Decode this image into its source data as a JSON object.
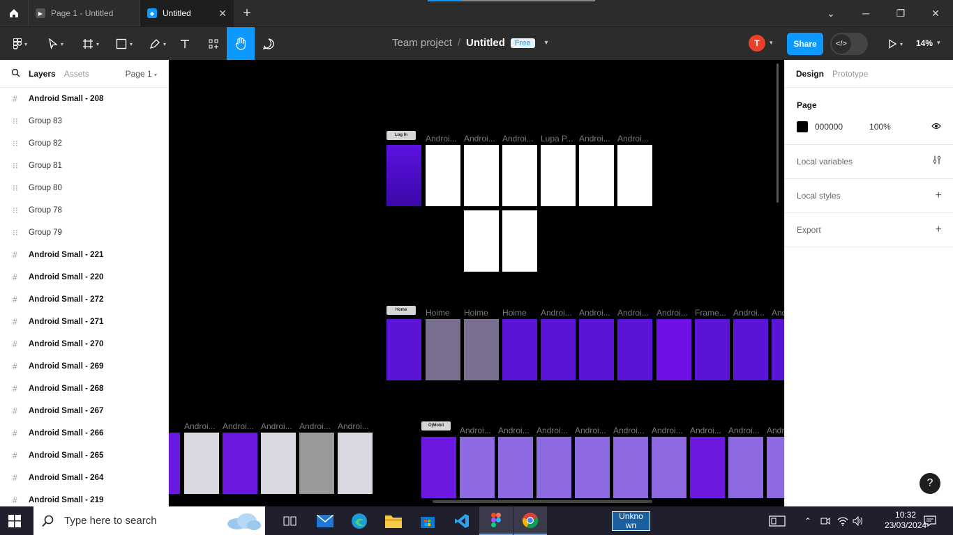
{
  "titlebar": {
    "tabs": [
      {
        "label": "Page 1 - Untitled",
        "active": false
      },
      {
        "label": "Untitled",
        "active": true
      }
    ]
  },
  "toolbar": {
    "team": "Team project",
    "file": "Untitled",
    "plan": "Free",
    "user_initial": "T",
    "share_label": "Share",
    "zoom": "14%"
  },
  "layers_panel": {
    "tab_layers": "Layers",
    "tab_assets": "Assets",
    "page_selector": "Page 1",
    "items": [
      {
        "name": "Android Small - 208",
        "kind": "frame"
      },
      {
        "name": "Group 83",
        "kind": "group"
      },
      {
        "name": "Group 82",
        "kind": "group"
      },
      {
        "name": "Group 81",
        "kind": "group"
      },
      {
        "name": "Group 80",
        "kind": "group"
      },
      {
        "name": "Group 78",
        "kind": "group"
      },
      {
        "name": "Group 79",
        "kind": "group"
      },
      {
        "name": "Android Small - 221",
        "kind": "frame"
      },
      {
        "name": "Android Small - 220",
        "kind": "frame"
      },
      {
        "name": "Android Small - 272",
        "kind": "frame"
      },
      {
        "name": "Android Small - 271",
        "kind": "frame"
      },
      {
        "name": "Android Small - 270",
        "kind": "frame"
      },
      {
        "name": "Android Small - 269",
        "kind": "frame"
      },
      {
        "name": "Android Small - 268",
        "kind": "frame"
      },
      {
        "name": "Android Small - 267",
        "kind": "frame"
      },
      {
        "name": "Android Small - 266",
        "kind": "frame"
      },
      {
        "name": "Android Small - 265",
        "kind": "frame"
      },
      {
        "name": "Android Small - 264",
        "kind": "frame"
      },
      {
        "name": "Android Small - 219",
        "kind": "frame"
      }
    ]
  },
  "design_panel": {
    "tab_design": "Design",
    "tab_prototype": "Prototype",
    "page_title": "Page",
    "page_color_hex": "000000",
    "page_opacity": "100%",
    "local_variables": "Local variables",
    "local_styles": "Local styles",
    "export": "Export"
  },
  "canvas": {
    "section_labels": {
      "login": "Log In",
      "home": "Home",
      "ojek": "OjMobil"
    },
    "row1_labels": [
      "Androi...",
      "Androi...",
      "Androi...",
      "Lupa P...",
      "Androi...",
      "Androi..."
    ],
    "row2_labels": [
      "Hoime",
      "Hoime",
      "Hoime",
      "Androi...",
      "Androi...",
      "Androi...",
      "Androi...",
      "Frame...",
      "Androi...",
      "And"
    ],
    "row3_left_labels": [
      "Androi...",
      "Androi...",
      "Androi...",
      "Androi...",
      "Androi..."
    ],
    "row3_right_labels": [
      "Androi...",
      "Androi...",
      "Androi...",
      "Androi...",
      "Androi...",
      "Androi...",
      "Androi...",
      "Androi...",
      "Andr"
    ]
  },
  "taskbar": {
    "search_placeholder": "Type here to search",
    "unknown_app": "Unkno wn",
    "time": "10:32",
    "date": "23/03/2024"
  }
}
